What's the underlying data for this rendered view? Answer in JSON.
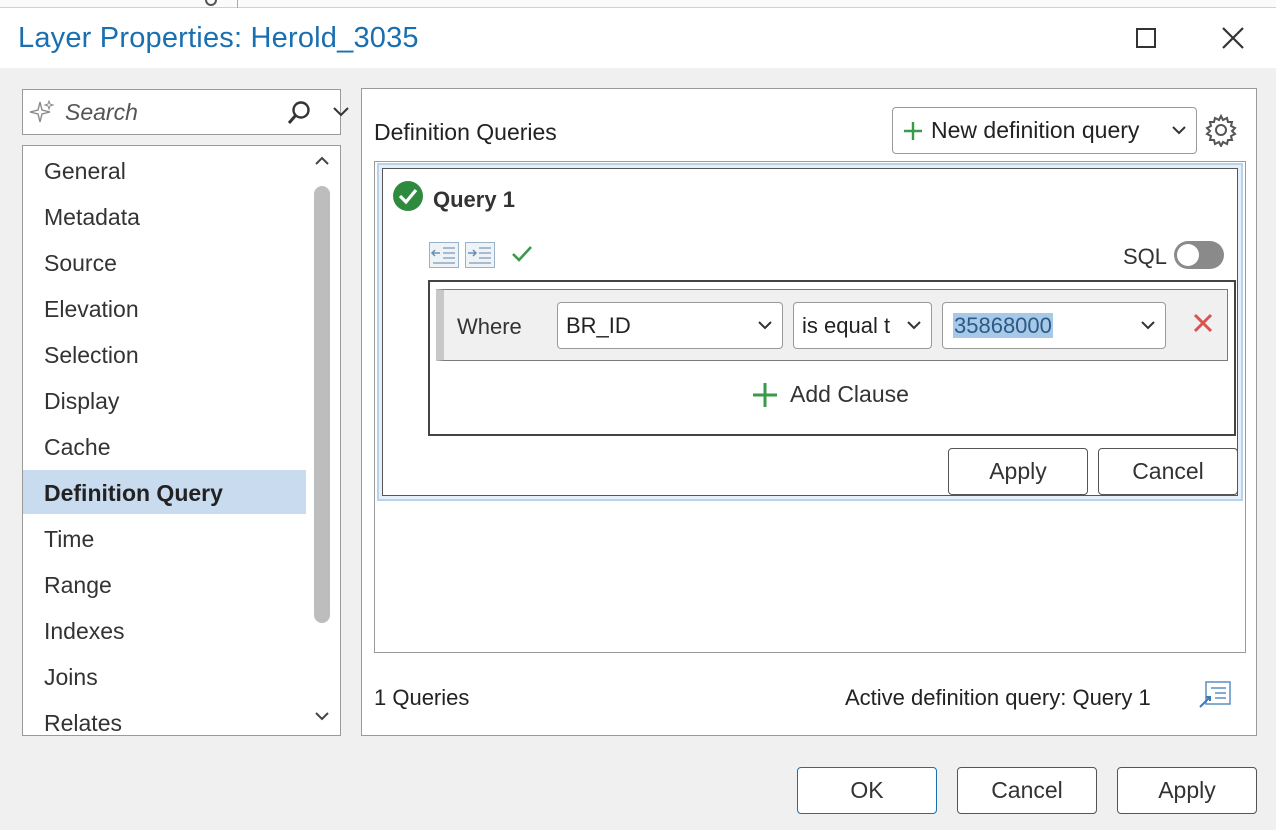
{
  "window": {
    "title": "Layer Properties: Herold_3035",
    "maximize_icon": "maximize-icon",
    "close_icon": "close-icon"
  },
  "search": {
    "placeholder": "Search"
  },
  "nav": {
    "items": [
      {
        "label": "General"
      },
      {
        "label": "Metadata"
      },
      {
        "label": "Source"
      },
      {
        "label": "Elevation"
      },
      {
        "label": "Selection"
      },
      {
        "label": "Display"
      },
      {
        "label": "Cache"
      },
      {
        "label": "Definition Query",
        "active": true
      },
      {
        "label": "Time"
      },
      {
        "label": "Range"
      },
      {
        "label": "Indexes"
      },
      {
        "label": "Joins"
      },
      {
        "label": "Relates"
      }
    ]
  },
  "panel": {
    "title": "Definition Queries",
    "new_query_label": "New definition query",
    "query": {
      "name": "Query 1",
      "sql_label": "SQL",
      "sql_enabled": false,
      "clause": {
        "where_label": "Where",
        "field": "BR_ID",
        "operator": "is equal t",
        "value": "35868000"
      },
      "add_clause_label": "Add Clause",
      "apply_label": "Apply",
      "cancel_label": "Cancel"
    },
    "query_count": "1 Queries",
    "active_query": "Active definition query: Query 1"
  },
  "footer": {
    "ok_label": "OK",
    "cancel_label": "Cancel",
    "apply_label": "Apply"
  },
  "colors": {
    "title_blue": "#1a6fb0",
    "active_nav": "#c9dcef",
    "check_green": "#2e8b3e",
    "delete_red": "#d9534f",
    "highlight": "#a8c8e8"
  }
}
